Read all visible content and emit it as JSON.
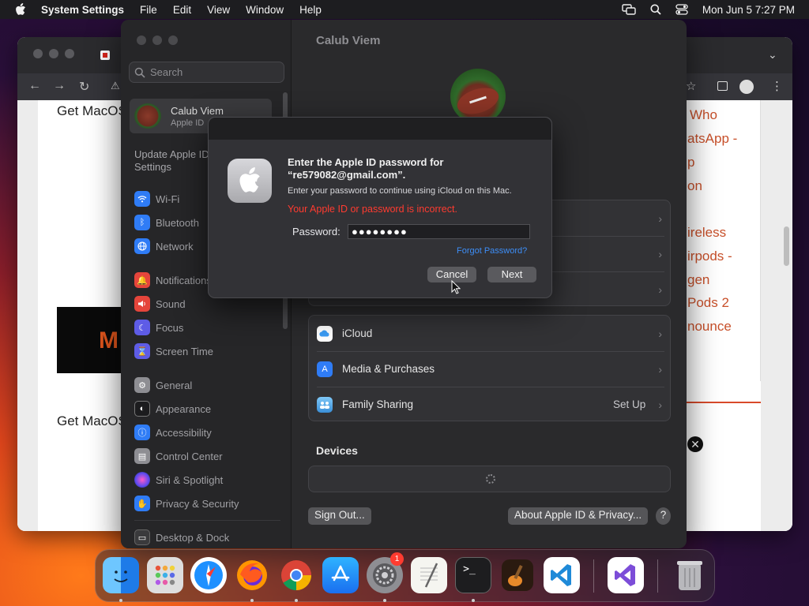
{
  "menubar": {
    "app_name": "System Settings",
    "menus": [
      "File",
      "Edit",
      "View",
      "Window",
      "Help"
    ],
    "clock": "Mon Jun 5  7:27 PM",
    "icons": [
      "apple-icon",
      "screen-mirroring-icon",
      "spotlight-icon",
      "control-center-icon"
    ]
  },
  "browser": {
    "left_texts": [
      "Get MacOS",
      "Get MacOS"
    ],
    "banner_letter": "M",
    "right_links": [
      "Who",
      "atsApp -",
      "p",
      "on",
      "ireless",
      "irpods -",
      "gen",
      "Pods 2",
      "nounce"
    ]
  },
  "settings": {
    "window_title": "Calub Viem",
    "search_placeholder": "Search",
    "profile": {
      "name": "Calub Viem",
      "subtitle": "Apple ID"
    },
    "update_notice": "Update Apple ID Settings",
    "sidebar_groups": [
      [
        {
          "label": "Wi-Fi",
          "icon": "wifi-icon",
          "color": "#2f7cf6"
        },
        {
          "label": "Bluetooth",
          "icon": "bluetooth-icon",
          "color": "#2f7cf6"
        },
        {
          "label": "Network",
          "icon": "network-icon",
          "color": "#2f7cf6"
        }
      ],
      [
        {
          "label": "Notifications",
          "icon": "bell-icon",
          "color": "#e5453b"
        },
        {
          "label": "Sound",
          "icon": "speaker-icon",
          "color": "#e5453b"
        },
        {
          "label": "Focus",
          "icon": "moon-icon",
          "color": "#5e5ce6"
        },
        {
          "label": "Screen Time",
          "icon": "hourglass-icon",
          "color": "#5e5ce6"
        }
      ],
      [
        {
          "label": "General",
          "icon": "gear-icon",
          "color": "#8e8e93"
        },
        {
          "label": "Appearance",
          "icon": "appearance-icon",
          "color": "#1c1c1e"
        },
        {
          "label": "Accessibility",
          "icon": "accessibility-icon",
          "color": "#2f7cf6"
        },
        {
          "label": "Control Center",
          "icon": "control-center-icon",
          "color": "#8e8e93"
        },
        {
          "label": "Siri & Spotlight",
          "icon": "siri-icon",
          "color": "#b04ad8"
        },
        {
          "label": "Privacy & Security",
          "icon": "hand-icon",
          "color": "#2f7cf6"
        }
      ],
      [
        {
          "label": "Desktop & Dock",
          "icon": "dock-icon",
          "color": "#3a3a3c"
        }
      ]
    ],
    "services": [
      {
        "label": "iCloud",
        "icon": "icloud-icon",
        "value": ""
      },
      {
        "label": "Media & Purchases",
        "icon": "app-store-icon",
        "value": ""
      },
      {
        "label": "Family Sharing",
        "icon": "family-sharing-icon",
        "value": "Set Up"
      }
    ],
    "devices_heading": "Devices",
    "sign_out_label": "Sign Out...",
    "about_label": "About Apple ID & Privacy...",
    "help_label": "?"
  },
  "dialog": {
    "title": "Enter the Apple ID password for “re579082@gmail.com”.",
    "message": "Enter your password to continue using iCloud on this Mac.",
    "error": "Your Apple ID or password is incorrect.",
    "password_label": "Password:",
    "password_value": "●●●●●●●●",
    "forgot_label": "Forgot Password?",
    "cancel_label": "Cancel",
    "next_label": "Next",
    "error_color": "#ff3b30",
    "link_color": "#3d8ef7"
  },
  "dock": {
    "apps": [
      "finder-icon",
      "launchpad-icon",
      "safari-icon",
      "firefox-icon",
      "chrome-icon",
      "app-store-icon",
      "system-settings-icon",
      "textedit-icon",
      "terminal-icon",
      "garageband-icon",
      "vscode-icon",
      "visual-studio-icon",
      "trash-icon"
    ],
    "settings_badge": "1"
  }
}
